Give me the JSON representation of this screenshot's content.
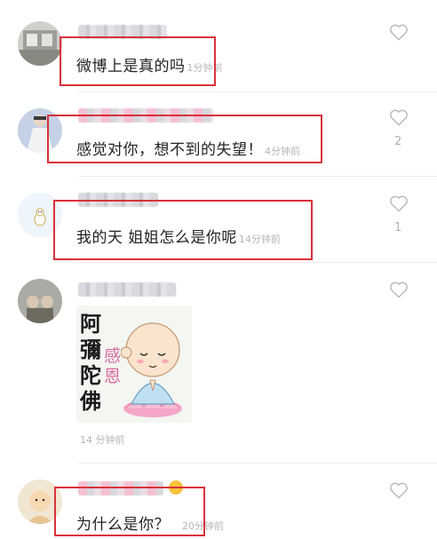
{
  "comments": [
    {
      "text": "微博上是真的吗",
      "time": "1分钟前",
      "likes": ""
    },
    {
      "text": "感觉对你，想不到的失望！",
      "time": "4分钟前",
      "likes": "2"
    },
    {
      "text": "我的天 姐姐怎么是你呢",
      "time": "14分钟前",
      "likes": "1"
    },
    {
      "text": "",
      "time": "14 分钟前",
      "likes": "",
      "sticker": {
        "line1": "阿彌陀佛",
        "line2": "感恩"
      }
    },
    {
      "text": "为什么是你？",
      "time": "20分钟前",
      "likes": ""
    }
  ],
  "colors": {
    "highlight_box": "#d9323a",
    "timestamp": "#b5b5b5",
    "text": "#222222"
  },
  "icons": {
    "like": "heart-outline-icon"
  }
}
